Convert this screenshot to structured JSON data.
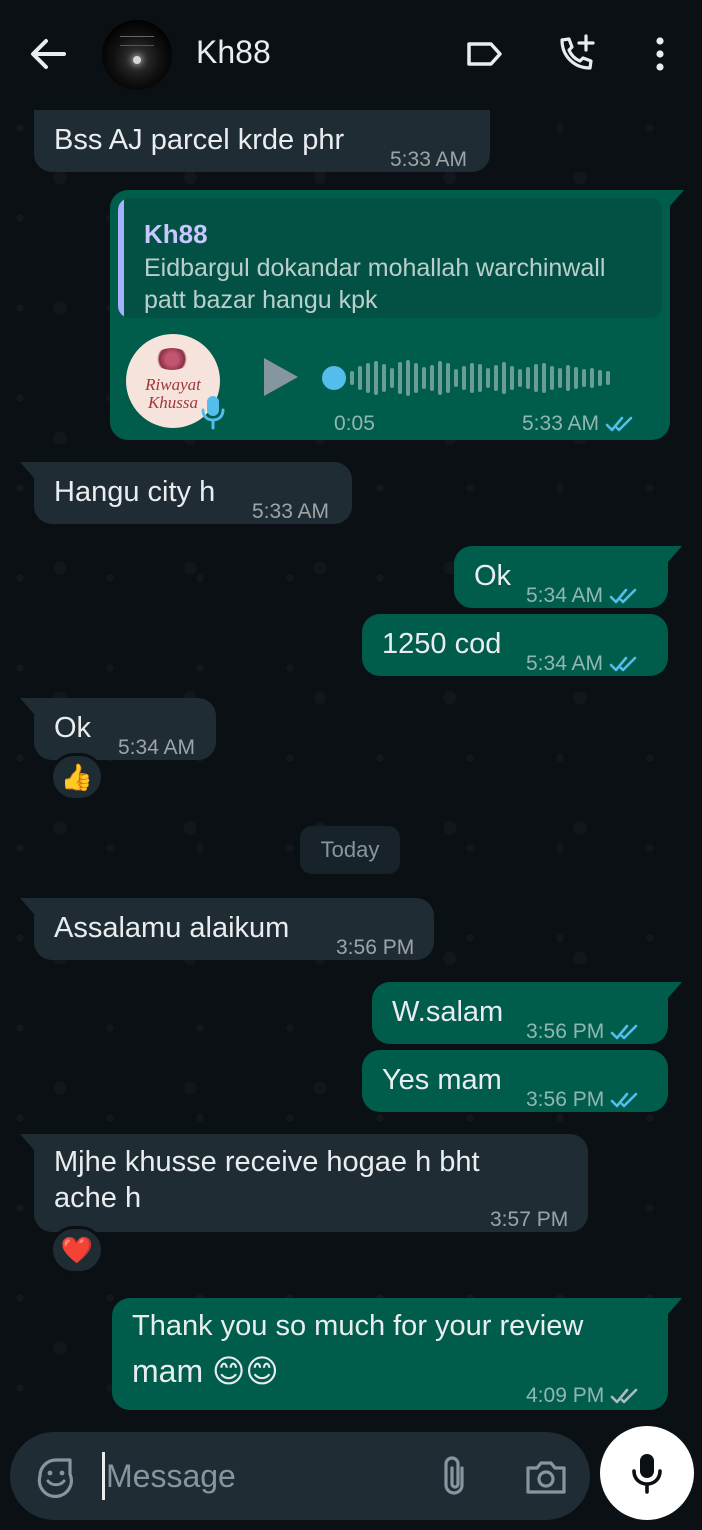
{
  "header": {
    "contact_name": "Kh88",
    "back_icon": "arrow-left-icon",
    "label_icon": "label-icon",
    "call_icon": "add-call-icon",
    "menu_icon": "more-vertical-icon"
  },
  "messages": [
    {
      "id": "m1",
      "direction": "in",
      "text": "Bss AJ parcel krde phr",
      "time": "5:33 AM"
    },
    {
      "id": "m2",
      "direction": "out",
      "type": "voice-reply",
      "quote": {
        "author": "Kh88",
        "text": "Eidbargul dokandar mohallah warchinwall patt bazar hangu kpk"
      },
      "voice_avatar_text": "Riwayat Khussa",
      "duration": "0:05",
      "time": "5:33 AM",
      "status": "read"
    },
    {
      "id": "m3",
      "direction": "in",
      "text": "Hangu city h",
      "time": "5:33 AM"
    },
    {
      "id": "m4",
      "direction": "out",
      "text": "Ok",
      "time": "5:34 AM",
      "status": "read"
    },
    {
      "id": "m5",
      "direction": "out",
      "text": "1250 cod",
      "time": "5:34 AM",
      "status": "read"
    },
    {
      "id": "m6",
      "direction": "in",
      "text": "Ok",
      "time": "5:34 AM",
      "reaction": "👍"
    },
    {
      "id": "m7",
      "direction": "in",
      "text": "Assalamu alaikum",
      "time": "3:56 PM"
    },
    {
      "id": "m8",
      "direction": "out",
      "text": "W.salam",
      "time": "3:56 PM",
      "status": "read"
    },
    {
      "id": "m9",
      "direction": "out",
      "text": "Yes mam",
      "time": "3:56 PM",
      "status": "read"
    },
    {
      "id": "m10",
      "direction": "in",
      "text_line1": "Mjhe khusse receive hogae h bht",
      "text_line2": "ache h",
      "time": "3:57 PM",
      "reaction": "❤️"
    },
    {
      "id": "m11",
      "direction": "out",
      "text_line1": "Thank you so much for your review",
      "text_line2": "mam 😊😊",
      "time": "4:09 PM",
      "status": "delivered"
    }
  ],
  "date_divider": "Today",
  "composer": {
    "placeholder": "Message",
    "value": "",
    "sticker_icon": "sticker-icon",
    "attach_icon": "paperclip-icon",
    "camera_icon": "camera-icon",
    "voice_icon": "microphone-icon"
  },
  "colors": {
    "background": "#0b1014",
    "incoming_bubble": "#202c33",
    "outgoing_bubble": "#005c4b",
    "read_ticks": "#53bdeb",
    "unread_ticks": "#8696a0"
  }
}
